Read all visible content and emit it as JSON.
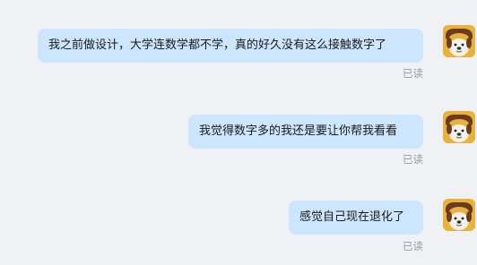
{
  "messages": [
    {
      "text": "我之前做设计，大学连数学都不学，真的好久没有这么接触数字了",
      "status": "已读"
    },
    {
      "text": "我觉得数字多的我还是要让你帮我看看",
      "status": "已读"
    },
    {
      "text": "感觉自己现在退化了",
      "status": "已读"
    }
  ],
  "colors": {
    "background": "#f0f1f4",
    "bubble": "#cce6ff",
    "status_text": "#9a9a9a",
    "avatar_bg": "#e9b23a"
  },
  "icons": {
    "avatar": "dog-avatar-icon"
  }
}
